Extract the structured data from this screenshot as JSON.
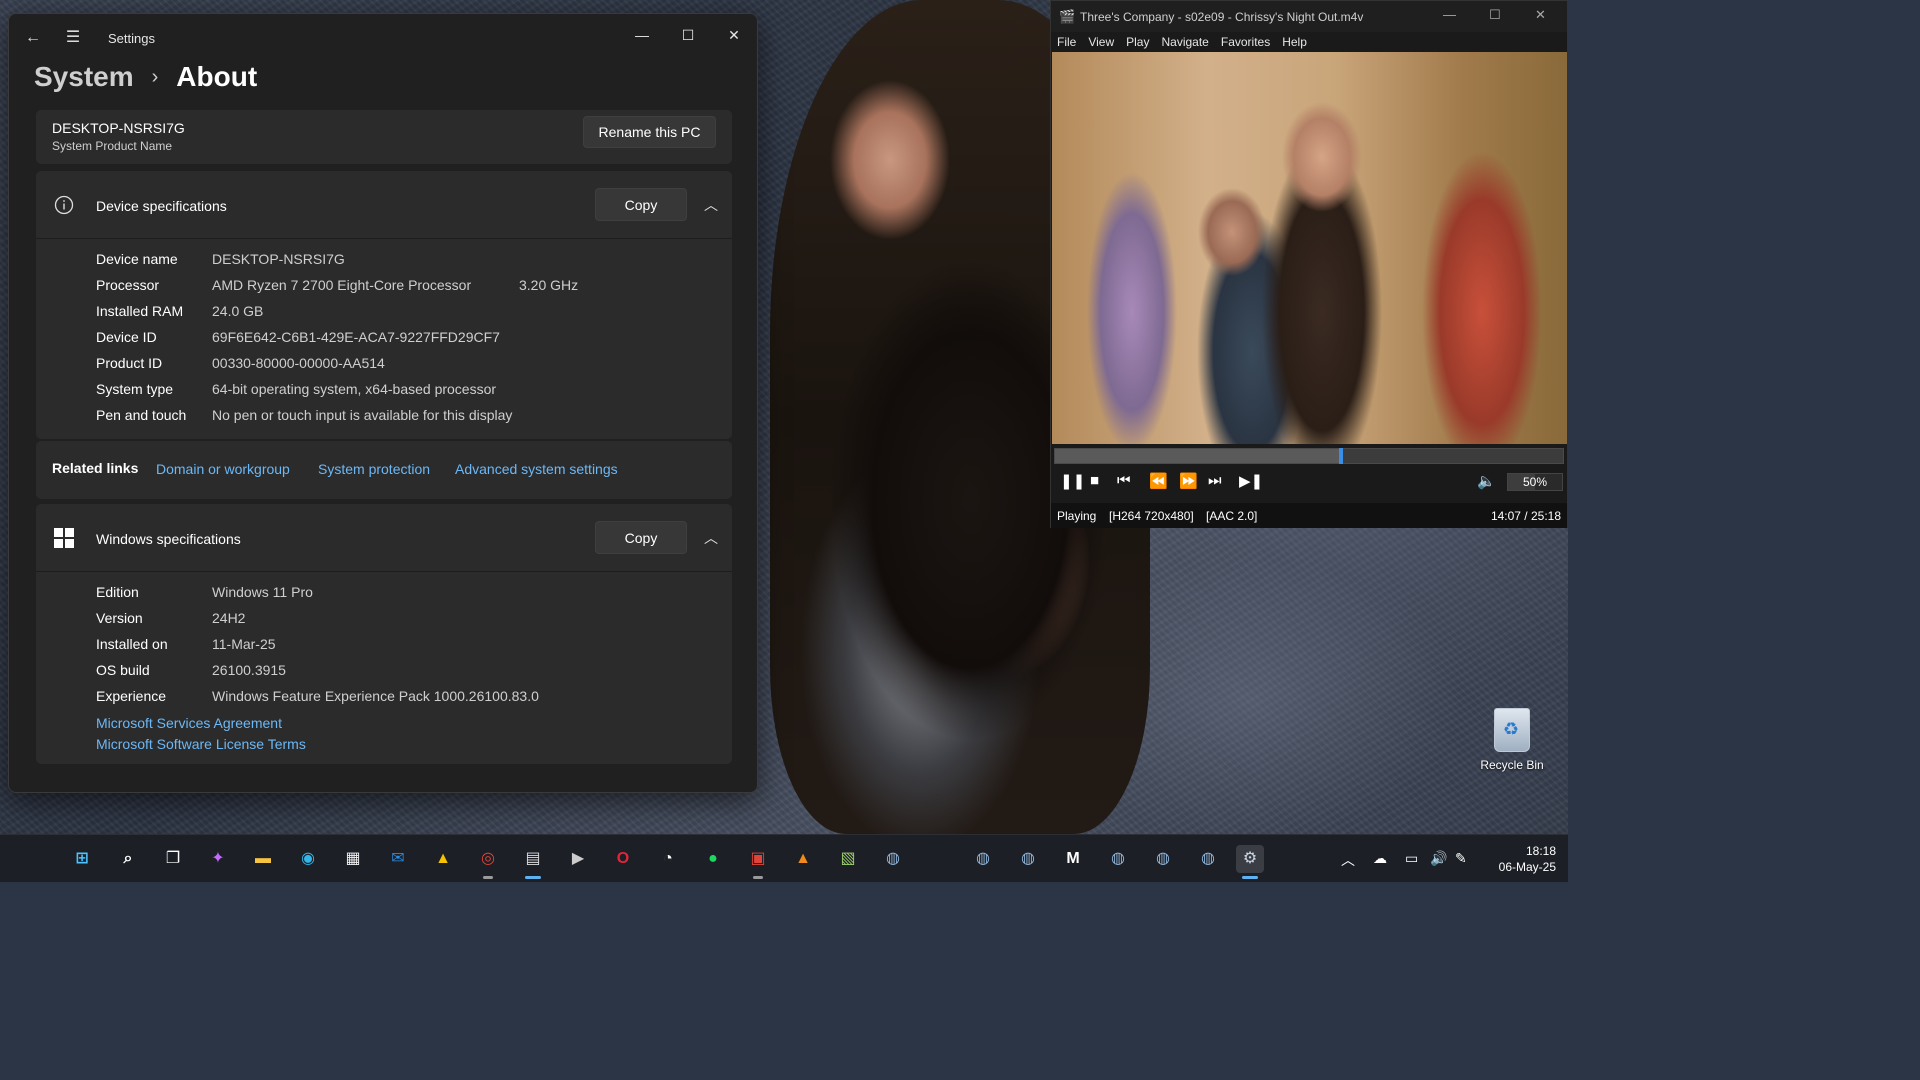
{
  "settings": {
    "app_name": "Settings",
    "breadcrumb_parent": "System",
    "breadcrumb_sep": "›",
    "breadcrumb_current": "About",
    "pc_name": "DESKTOP-NSRSI7G",
    "pc_name_sub": "System Product Name",
    "rename_button": "Rename this PC",
    "device_specs": {
      "title": "Device specifications",
      "copy_label": "Copy",
      "rows": [
        {
          "label": "Device name",
          "value": "DESKTOP-NSRSI7G"
        },
        {
          "label": "Processor",
          "value": "AMD Ryzen 7 2700 Eight-Core Processor",
          "extra": "3.20 GHz"
        },
        {
          "label": "Installed RAM",
          "value": "24.0 GB"
        },
        {
          "label": "Device ID",
          "value": "69F6E642-C6B1-429E-ACA7-9227FFD29CF7"
        },
        {
          "label": "Product ID",
          "value": "00330-80000-00000-AA514"
        },
        {
          "label": "System type",
          "value": "64-bit operating system, x64-based processor"
        },
        {
          "label": "Pen and touch",
          "value": "No pen or touch input is available for this display"
        }
      ]
    },
    "related_links": {
      "label": "Related links",
      "links": [
        "Domain or workgroup",
        "System protection",
        "Advanced system settings"
      ]
    },
    "windows_specs": {
      "title": "Windows specifications",
      "copy_label": "Copy",
      "rows": [
        {
          "label": "Edition",
          "value": "Windows 11 Pro"
        },
        {
          "label": "Version",
          "value": "24H2"
        },
        {
          "label": "Installed on",
          "value": "11-Mar-25"
        },
        {
          "label": "OS build",
          "value": "26100.3915"
        },
        {
          "label": "Experience",
          "value": "Windows Feature Experience Pack 1000.26100.83.0"
        }
      ],
      "links": [
        "Microsoft Services Agreement",
        "Microsoft Software License Terms"
      ]
    }
  },
  "player": {
    "title": "Three's Company - s02e09 - Chrissy's Night Out.m4v",
    "menu": [
      "File",
      "View",
      "Play",
      "Navigate",
      "Favorites",
      "Help"
    ],
    "seek_fraction": 0.56,
    "volume_percent": "50%",
    "volume_fraction": 0.5,
    "status": "Playing",
    "video_format": "[H264 720x480]",
    "audio_format": "[AAC 2.0]",
    "time": "14:07 / 25:18"
  },
  "desktop": {
    "recycle_bin_label": "Recycle Bin"
  },
  "taskbar": {
    "clock_time": "18:18",
    "clock_date": "06-May-25",
    "accent_color": "#5fb2f2"
  }
}
